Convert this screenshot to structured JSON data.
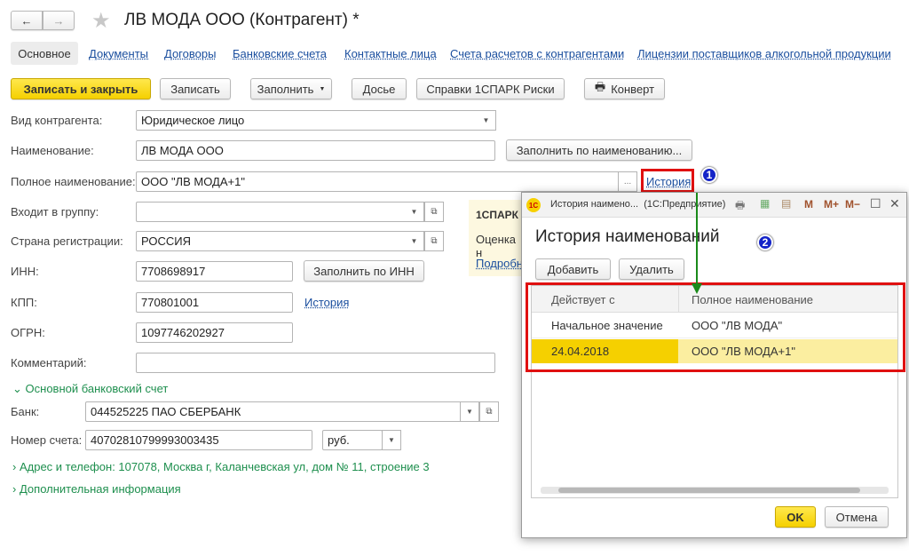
{
  "header": {
    "title": "ЛВ МОДА ООО (Контрагент) *",
    "back": "←",
    "forward": "→"
  },
  "tabs": [
    "Основное",
    "Документы",
    "Договоры",
    "Банковские счета",
    "Контактные лица",
    "Счета расчетов с контрагентами",
    "Лицензии поставщиков алкогольной продукции"
  ],
  "toolbar": {
    "save_close": "Записать и закрыть",
    "save": "Записать",
    "fill": "Заполнить",
    "dossier": "Досье",
    "spark": "Справки 1СПАРК Риски",
    "envelope": "Конверт"
  },
  "form": {
    "kind_label": "Вид контрагента:",
    "kind_value": "Юридическое лицо",
    "name_label": "Наименование:",
    "name_value": "ЛВ МОДА ООО",
    "fill_by_name": "Заполнить по наименованию...",
    "fullname_label": "Полное наименование:",
    "fullname_value": "ООО \"ЛВ МОДА+1\"",
    "ellipsis": "...",
    "history": "История",
    "group_label": "Входит в группу:",
    "group_value": "",
    "country_label": "Страна регистрации:",
    "country_value": "РОССИЯ",
    "inn_label": "ИНН:",
    "inn_value": "7708698917",
    "fill_by_inn": "Заполнить по ИНН",
    "kpp_label": "КПП:",
    "kpp_value": "770801001",
    "kpp_history": "История",
    "ogrn_label": "ОГРН:",
    "ogrn_value": "1097746202927",
    "comment_label": "Комментарий:",
    "comment_value": "",
    "bank_section": "Основной банковский счет",
    "bank_label": "Банк:",
    "bank_value": "044525225 ПАО СБЕРБАНК",
    "account_label": "Номер счета:",
    "account_value": "40702810799993003435",
    "currency": "руб.",
    "address_section": "Адрес и телефон: 107078, Москва г, Каланчевская ул, дом № 11, строение 3",
    "extra_section": "Дополнительная информация"
  },
  "spark_panel": {
    "title": "1СПАРК",
    "line": "Оценка н",
    "link": "Подробн"
  },
  "annotations": {
    "one": "1",
    "two": "2"
  },
  "dialog": {
    "window_title": "История наимено...  (1С:Предприятие)",
    "tools": [
      "M",
      "M+",
      "M−"
    ],
    "heading": "История наименований",
    "add": "Добавить",
    "delete": "Удалить",
    "columns": [
      "Действует с",
      "Полное наименование"
    ],
    "rows": [
      [
        "Начальное значение",
        "ООО \"ЛВ МОДА\""
      ],
      [
        "24.04.2018",
        "ООО \"ЛВ МОДА+1\""
      ]
    ],
    "ok": "OK",
    "cancel": "Отмена"
  },
  "colors": {
    "accent_yellow": "#f5d000",
    "link": "#1a4e9e",
    "section_green": "#1e8f4e",
    "highlight_red": "#e01010",
    "annotation_blue": "#1424c8",
    "arrow_green": "#1a8a1a"
  }
}
